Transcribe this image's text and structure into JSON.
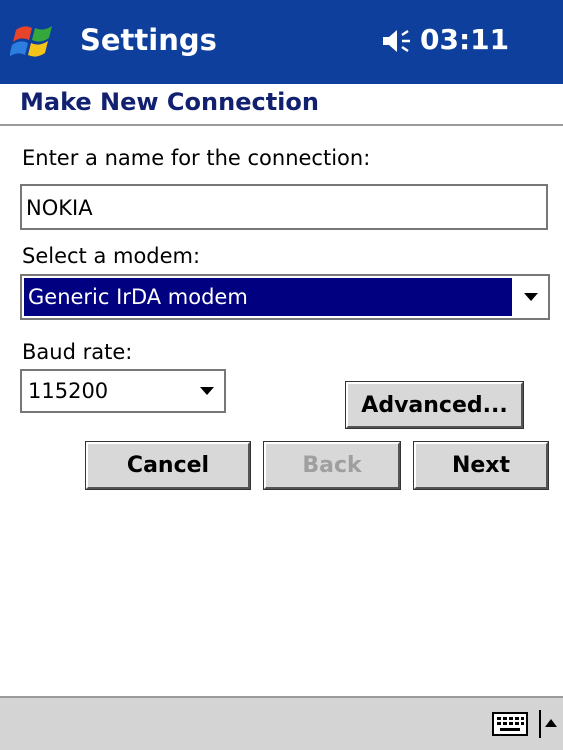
{
  "titlebar": {
    "app_title": "Settings",
    "clock": "03:11",
    "start_icon": "windows-flag-icon",
    "volume_icon": "speaker-icon"
  },
  "page": {
    "title": "Make New Connection"
  },
  "form": {
    "name_label": "Enter a name for the connection:",
    "name_value": "NOKIA",
    "modem_label": "Select a modem:",
    "modem_value": "Generic IrDA modem",
    "baud_label": "Baud rate:",
    "baud_value": "115200"
  },
  "buttons": {
    "advanced": "Advanced...",
    "cancel": "Cancel",
    "back": "Back",
    "next": "Next"
  },
  "taskbar": {
    "keyboard_icon": "keyboard-icon",
    "sip_icon": "up-arrow-icon"
  },
  "colors": {
    "titlebar": "#0e3f9d",
    "page_title": "#12216f",
    "selection": "#000080"
  }
}
